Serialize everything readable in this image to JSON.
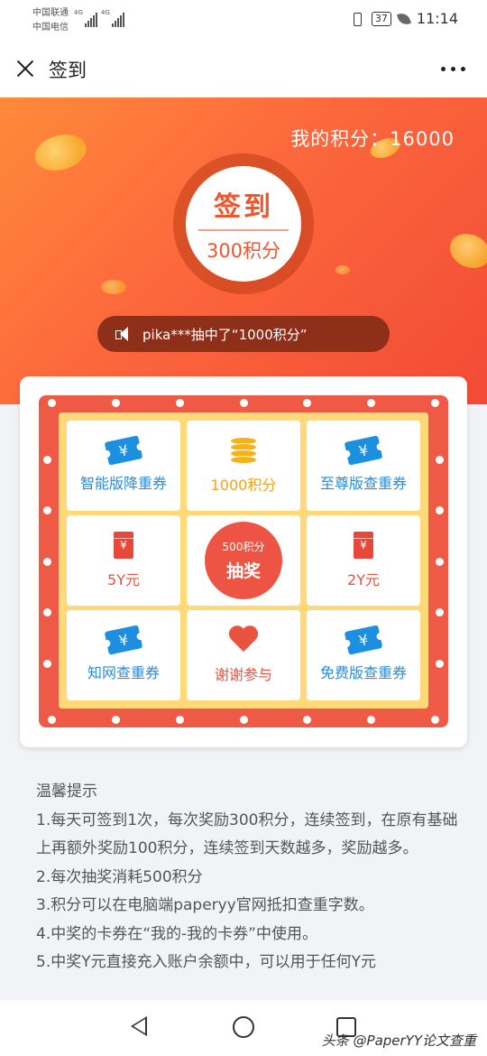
{
  "status_bar": {
    "carrier1": "中国联通",
    "carrier2": "中国电信",
    "sim1_type": "4G",
    "sim2_type": "4G",
    "battery": "37",
    "time": "11:14"
  },
  "app_bar": {
    "title": "签到",
    "close_icon": "close-icon",
    "more_icon": "more-icon"
  },
  "banner": {
    "points_text": "我的积分：16000",
    "checkin_label": "签到",
    "checkin_reward": "300积分",
    "ticker_text": "pika***抽中了“1000积分”"
  },
  "lottery": {
    "prizes": [
      {
        "label": "智能版降重券",
        "icon": "ticket-icon",
        "color": "blue"
      },
      {
        "label": "1000积分",
        "icon": "coins-icon",
        "color": "orange"
      },
      {
        "label": "至尊版查重券",
        "icon": "ticket-icon",
        "color": "blue"
      },
      {
        "label": "5Y元",
        "icon": "red-envelope-icon",
        "color": "red"
      },
      {
        "label": "2Y元",
        "icon": "red-envelope-icon",
        "color": "red"
      },
      {
        "label": "知网查重券",
        "icon": "ticket-icon",
        "color": "blue"
      },
      {
        "label": "谢谢参与",
        "icon": "broken-heart-icon",
        "color": "red"
      },
      {
        "label": "免费版查重券",
        "icon": "ticket-icon",
        "color": "blue"
      }
    ],
    "draw_button": {
      "cost": "500积分",
      "label": "抽奖"
    },
    "ticket_symbol": "¥",
    "envelope_symbol": "¥"
  },
  "tips": {
    "title": "温馨提示",
    "line1": "1.每天可签到1次，每次奖励300积分，连续签到，在原有基础上再额外奖励100积分，连续签到天数越多，奖励越多。",
    "line2": "2.每次抽奖消耗500积分",
    "line3": "3.积分可以在电脑端paperyy官网抵扣查重字数。",
    "line4": "4.中奖的卡券在“我的-我的卡券”中使用。",
    "line5": "5.中奖Y元直接充入账户余额中，可以用于任何Y元"
  },
  "nav_bar": {
    "watermark": "头条 @PaperYY论文查重"
  },
  "colors": {
    "banner_start": "#ff8a3a",
    "banner_end": "#f24a36",
    "frame": "#ef5a47",
    "grid_bg": "#ffd877",
    "blue_text": "#2a8cd6",
    "orange_text": "#f5a21c",
    "red_text": "#e8523e"
  }
}
